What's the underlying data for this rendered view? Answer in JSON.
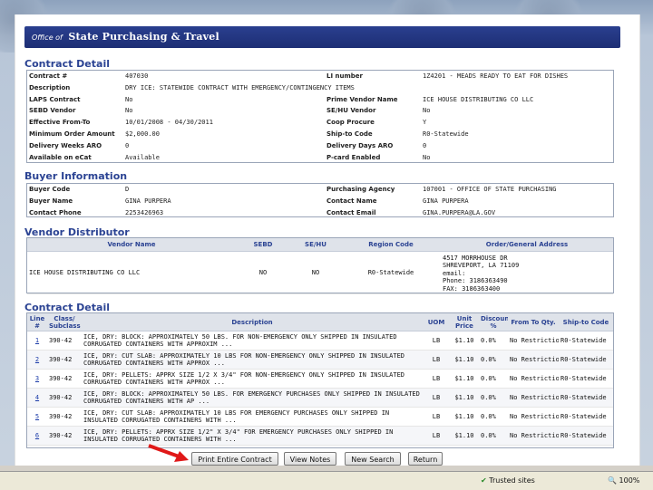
{
  "banner": {
    "prefix": "Office of",
    "title": "State Purchasing & Travel"
  },
  "contract_detail": {
    "title": "Contract Detail",
    "rows": [
      [
        "Contract #",
        "407030",
        "LI number",
        "1Z4201 - MEADS READY TO EAT FOR DISHES"
      ],
      [
        "Description",
        "DRY ICE: STATEWIDE CONTRACT WITH EMERGENCY/CONTINGENCY ITEMS",
        "",
        ""
      ],
      [
        "LAPS Contract",
        "No",
        "Prime Vendor Name",
        "ICE HOUSE DISTRIBUTING CO LLC"
      ],
      [
        "SEBD Vendor",
        "No",
        "SE/HU Vendor",
        "No"
      ],
      [
        "Effective From-To",
        "10/01/2008 - 04/30/2011",
        "Coop Procure",
        "Y"
      ],
      [
        "Minimum Order Amount",
        "$2,000.00",
        "Ship-to Code",
        "R0-Statewide"
      ],
      [
        "Delivery Weeks ARO",
        "0",
        "Delivery Days ARO",
        "0"
      ],
      [
        "Available on eCat",
        "Available",
        "P-card Enabled",
        "No"
      ]
    ]
  },
  "buyer_info": {
    "title": "Buyer Information",
    "rows": [
      [
        "Buyer Code",
        "D",
        "Purchasing Agency",
        "107001 - OFFICE OF STATE PURCHASING"
      ],
      [
        "Buyer Name",
        "GINA PURPERA",
        "Contact Name",
        "GINA PURPERA"
      ],
      [
        "Contact Phone",
        "2253426963",
        "Contact Email",
        "GINA.PURPERA@LA.GOV"
      ]
    ]
  },
  "vendor_distributor": {
    "title": "Vendor Distributor",
    "headers": [
      "Vendor Name",
      "SEBD",
      "SE/HU",
      "Region Code",
      "Order/General Address"
    ],
    "row": {
      "name": "ICE HOUSE DISTRIBUTING CO LLC",
      "sebd": "NO",
      "sehu": "NO",
      "region": "R0-Statewide",
      "address": [
        "4517 MORRHOUSE DR",
        "SHREVEPORT, LA 71109",
        "email:",
        "Phone: 3186363490",
        "FAX: 3186363400"
      ]
    }
  },
  "contract_lines": {
    "title": "Contract Detail",
    "headers": [
      "Line #",
      "Class/ Subclass",
      "Description",
      "UOM",
      "Unit Price",
      "Discount %",
      "From To Qty.",
      "Ship-to Code"
    ],
    "rows": [
      [
        "1",
        "390-42",
        "ICE, DRY: BLOCK: APPROXIMATELY 50 LBS. FOR NON-EMERGENCY ONLY SHIPPED IN INSULATED CORRUGATED CONTAINERS WITH APPROXIM ...",
        "LB",
        "$1.10",
        "0.0%",
        "No Restriction",
        "R0-Statewide"
      ],
      [
        "2",
        "390-42",
        "ICE, DRY: CUT SLAB: APPROXIMATELY 10 LBS FOR NON-EMERGENCY ONLY SHIPPED IN INSULATED CORRUGATED CONTAINERS WITH APPROX ...",
        "LB",
        "$1.10",
        "0.0%",
        "No Restriction",
        "R0-Statewide"
      ],
      [
        "3",
        "390-42",
        "ICE, DRY: PELLETS: APPRX SIZE 1/2 X 3/4\" FOR NON-EMERGENCY ONLY SHIPPED IN INSULATED CORRUGATED CONTAINERS WITH APPROX ...",
        "LB",
        "$1.10",
        "0.0%",
        "No Restriction",
        "R0-Statewide"
      ],
      [
        "4",
        "390-42",
        "ICE, DRY: BLOCK: APPROXIMATELY 50 LBS. FOR EMERGENCY PURCHASES ONLY SHIPPED IN INSULATED CORRUGATED CONTAINERS WITH AP ...",
        "LB",
        "$1.10",
        "0.0%",
        "No Restriction",
        "R0-Statewide"
      ],
      [
        "5",
        "390-42",
        "ICE, DRY: CUT SLAB: APPROXIMATELY 10 LBS FOR EMERGENCY PURCHASES ONLY SHIPPED IN INSULATED CORRUGATED CONTAINERS WITH ...",
        "LB",
        "$1.10",
        "0.0%",
        "No Restriction",
        "R0-Statewide"
      ],
      [
        "6",
        "390-42",
        "ICE, DRY: PELLETS: APPRX SIZE 1/2\" X 3/4\" FOR EMERGENCY PURCHASES ONLY SHIPPED IN INSULATED CORRUGATED CONTAINERS WITH ...",
        "LB",
        "$1.10",
        "0.0%",
        "No Restriction",
        "R0-Statewide"
      ]
    ]
  },
  "buttons": {
    "print": "Print Entire Contract",
    "notes": "View Notes",
    "search": "New Search",
    "return": "Return"
  },
  "status": {
    "zone": "Trusted sites",
    "zoom": "100%"
  },
  "colors": {
    "banner": "#1d2e74",
    "section_title": "#2b4393",
    "arrow": "#e01818"
  }
}
